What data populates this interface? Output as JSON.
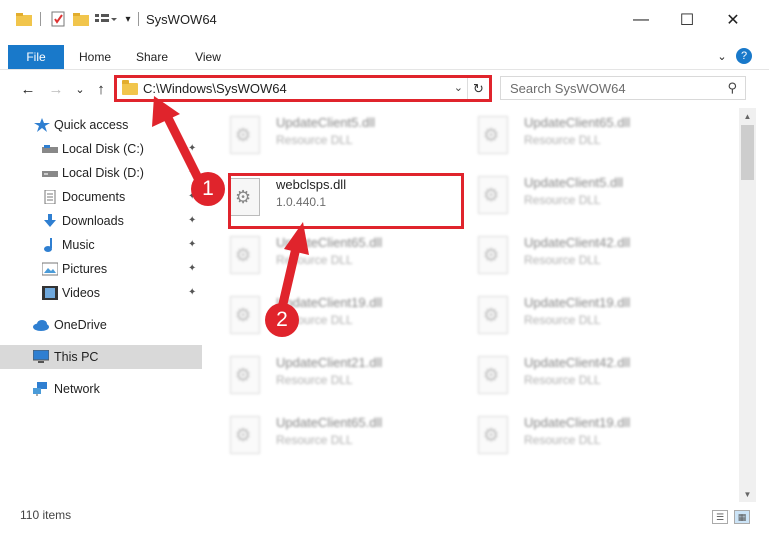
{
  "window": {
    "title": "SysWOW64",
    "minimize_glyph": "—",
    "maximize_glyph": "☐",
    "close_glyph": "✕"
  },
  "ribbon": {
    "tabs": [
      "File",
      "Home",
      "Share",
      "View"
    ],
    "help_glyph": "?",
    "collapse_glyph": "⌄"
  },
  "address_bar": {
    "path": "C:\\Windows\\SysWOW64",
    "dropdown_glyph": "⌄",
    "refresh_glyph": "↻"
  },
  "search": {
    "placeholder": "Search SysWOW64",
    "icon_glyph": "⚲"
  },
  "navigation": {
    "back_glyph": "←",
    "forward_glyph": "→",
    "recent_glyph": "⌄",
    "up_glyph": "↑"
  },
  "sidebar": {
    "items": [
      {
        "label": "Quick access"
      },
      {
        "label": "Local Disk (C:)"
      },
      {
        "label": "Local Disk (D:)"
      },
      {
        "label": "Documents"
      },
      {
        "label": "Downloads"
      },
      {
        "label": "Music"
      },
      {
        "label": "Pictures"
      },
      {
        "label": "Videos"
      },
      {
        "label": "OneDrive"
      },
      {
        "label": "This PC"
      },
      {
        "label": "Network"
      }
    ],
    "pin_glyph": "📌"
  },
  "files": [
    {
      "name": "UpdateClient5.dll",
      "type": "Resource DLL"
    },
    {
      "name": "UpdateClient65.dll",
      "type": "Resource DLL"
    },
    {
      "name": "webclsps.dll",
      "type": "1.0.440.1"
    },
    {
      "name": "UpdateClient5.dll",
      "type": "Resource DLL"
    },
    {
      "name": "UpdateClient65.dll",
      "type": "Resource DLL"
    },
    {
      "name": "UpdateClient42.dll",
      "type": "Resource DLL"
    },
    {
      "name": "UpdateClient19.dll",
      "type": "Resource DLL"
    },
    {
      "name": "UpdateClient19.dll",
      "type": "Resource DLL"
    },
    {
      "name": "UpdateClient21.dll",
      "type": "Resource DLL"
    },
    {
      "name": "UpdateClient42.dll",
      "type": "Resource DLL"
    },
    {
      "name": "UpdateClient65.dll",
      "type": "Resource DLL"
    },
    {
      "name": "UpdateClient19.dll",
      "type": "Resource DLL"
    }
  ],
  "status_bar": {
    "item_count": "110 items"
  },
  "annotations": {
    "step1": "1",
    "step2": "2",
    "accent_color": "#e0242c"
  },
  "colors": {
    "file_tab": "#1979ca",
    "selected_nav": "#d9d9d9"
  }
}
